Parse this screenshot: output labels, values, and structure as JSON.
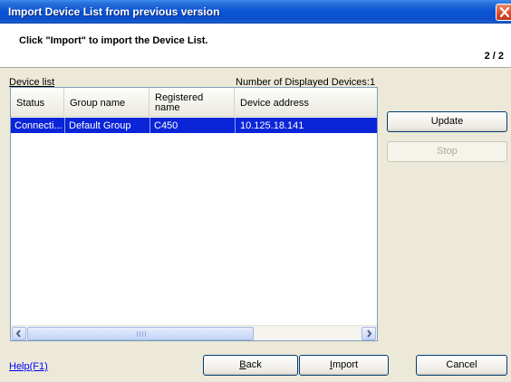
{
  "window": {
    "title": "Import Device List from previous version"
  },
  "header": {
    "instruction": "Click \"Import\" to import the Device List.",
    "page_indicator": "2 / 2"
  },
  "list": {
    "label": "Device list",
    "count_label": "Number of Displayed Devices:",
    "count_value": "1",
    "columns": [
      "Status",
      "Group name",
      "Registered",
      "name",
      "Device address"
    ],
    "rows": [
      {
        "status": "Connecti...",
        "group": "Default Group",
        "name": "C450",
        "address": "10.125.18.141"
      }
    ]
  },
  "buttons": {
    "update": "Update",
    "stop": "Stop",
    "back_mnemonic": "B",
    "back_rest": "ack",
    "import_mnemonic": "I",
    "import_rest": "mport",
    "cancel": "Cancel",
    "help": "Help(F1)"
  },
  "colors": {
    "title_bar": "#0a54d6",
    "selection": "#0a24d8",
    "link": "#0000ff"
  },
  "icons": {
    "close": "close-icon",
    "scroll_left": "arrow-left-icon",
    "scroll_right": "arrow-right-icon"
  }
}
